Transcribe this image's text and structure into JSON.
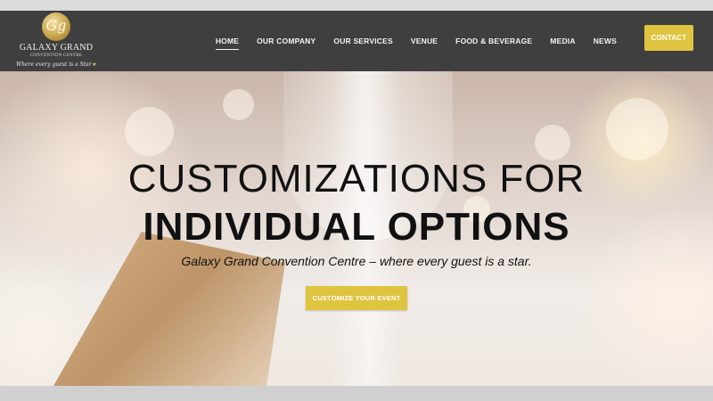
{
  "brand": {
    "monogram": "Gg",
    "name": "GALAXY GRAND",
    "sub": "CONVENTION CENTRE",
    "tagline": "Where every guest is a Star",
    "tagline_star": "★"
  },
  "nav": {
    "items": [
      "HOME",
      "OUR COMPANY",
      "OUR SERVICES",
      "VENUE",
      "FOOD & BEVERAGE",
      "MEDIA",
      "NEWS"
    ],
    "active": "HOME",
    "contact_label": "CONTACT"
  },
  "hero": {
    "title_line1": "CUSTOMIZATIONS FOR",
    "title_line2": "INDIVIDUAL OPTIONS",
    "subtitle": "Galaxy Grand Convention Centre – where every guest is a star.",
    "cta_label": "CUSTOMIZE YOUR EVENT"
  },
  "colors": {
    "header_bg": "#3f3f3f",
    "accent": "#dfc440",
    "hero_text": "#111111"
  }
}
